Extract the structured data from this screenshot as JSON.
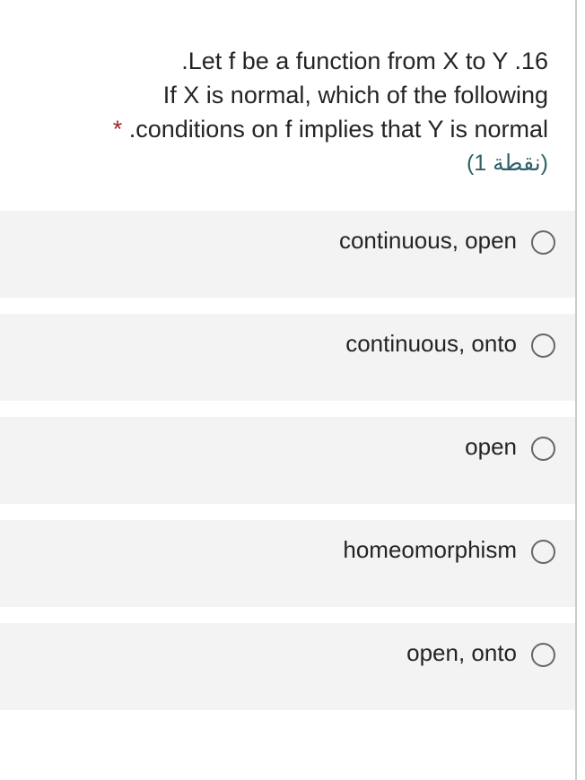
{
  "question": {
    "number_text": ".16",
    "line1": ".Let f be a function from X to Y",
    "line2": "If X is normal, which of the following",
    "line3": ".conditions on f implies that Y is normal",
    "required": "*",
    "points": "(1 نقطة)"
  },
  "options": [
    {
      "label": "continuous, open"
    },
    {
      "label": "continuous, onto"
    },
    {
      "label": "open"
    },
    {
      "label": "homeomorphism"
    },
    {
      "label": "open, onto"
    }
  ]
}
